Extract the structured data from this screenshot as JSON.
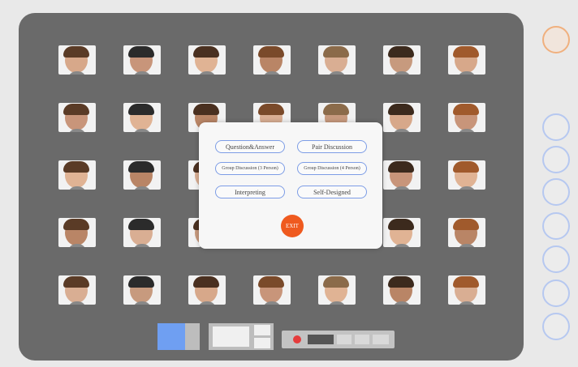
{
  "dialog": {
    "buttons": [
      {
        "label": "Question&Answer"
      },
      {
        "label": "Pair Discussion"
      },
      {
        "label": "Group Discussion (3 Person)"
      },
      {
        "label": "Group Discussion (4 Person)"
      },
      {
        "label": "Interpreting"
      },
      {
        "label": "Self-Designed"
      }
    ],
    "exit_label": "EXIT"
  },
  "colors": {
    "stage": "#6a6a6a",
    "pill_border": "#7d9de6",
    "exit": "#ef5a1f",
    "record": "#e53c3c",
    "rail_border": "#b6c8f0",
    "rail_top_border": "#f0b07e"
  },
  "participants_grid": {
    "rows": 5,
    "columns": 7
  },
  "icons": [
    "record-icon",
    "webcam-preview-icon",
    "participant-avatar-icon"
  ]
}
